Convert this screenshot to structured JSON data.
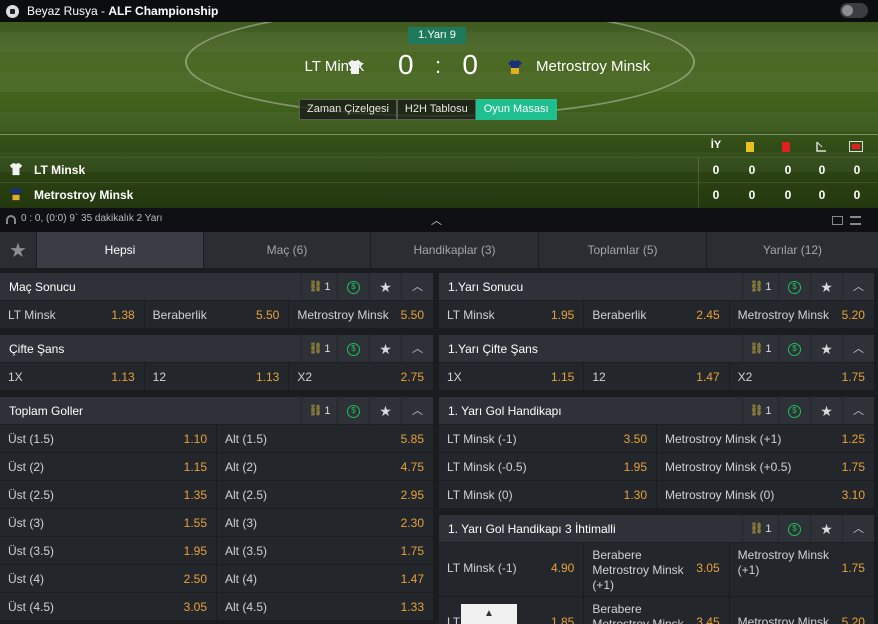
{
  "header": {
    "sport": "Beyaz Rusya",
    "separator": " - ",
    "league": "ALF Championship"
  },
  "match": {
    "period": "1.Yarı 9",
    "home_team": "LT Minsk",
    "away_team": "Metrostroy Minsk",
    "home_score": "0",
    "colon": ":",
    "away_score": "0",
    "view_tabs": [
      "Zaman Çizelgesi",
      "H2H Tablosu",
      "Oyun Masası"
    ],
    "active_view": "Oyun Masası"
  },
  "stats": {
    "ht_label": "İY",
    "rows": [
      {
        "team": "LT Minsk",
        "values": [
          "0",
          "0",
          "0",
          "0",
          "0"
        ]
      },
      {
        "team": "Metrostroy Minsk",
        "values": [
          "0",
          "0",
          "0",
          "0",
          "0"
        ]
      }
    ]
  },
  "info": {
    "text": "0 : 0, (0:0) 9` 35 dakikalık 2 Yarı"
  },
  "tabs": [
    {
      "label": "Hepsi",
      "active": true
    },
    {
      "label": "Maç (6)"
    },
    {
      "label": "Handikaplar (3)"
    },
    {
      "label": "Toplamlar (5)"
    },
    {
      "label": "Yarılar (12)"
    }
  ],
  "markets_left": [
    {
      "title": "Maç Sonucu",
      "links": "1",
      "rows": [
        [
          {
            "l": "LT Minsk",
            "o": "1.38"
          },
          {
            "l": "Beraberlik",
            "o": "5.50"
          },
          {
            "l": "Metrostroy Minsk",
            "o": "5.50"
          }
        ]
      ]
    },
    {
      "title": "Çifte Şans",
      "links": "1",
      "rows": [
        [
          {
            "l": "1X",
            "o": "1.13"
          },
          {
            "l": "12",
            "o": "1.13"
          },
          {
            "l": "X2",
            "o": "2.75"
          }
        ]
      ]
    },
    {
      "title": "Toplam Goller",
      "links": "1",
      "rows": [
        [
          {
            "l": "Üst (1.5)",
            "o": "1.10"
          },
          {
            "l": "Alt (1.5)",
            "o": "5.85"
          }
        ],
        [
          {
            "l": "Üst (2)",
            "o": "1.15"
          },
          {
            "l": "Alt (2)",
            "o": "4.75"
          }
        ],
        [
          {
            "l": "Üst (2.5)",
            "o": "1.35"
          },
          {
            "l": "Alt (2.5)",
            "o": "2.95"
          }
        ],
        [
          {
            "l": "Üst (3)",
            "o": "1.55"
          },
          {
            "l": "Alt (3)",
            "o": "2.30"
          }
        ],
        [
          {
            "l": "Üst (3.5)",
            "o": "1.95"
          },
          {
            "l": "Alt (3.5)",
            "o": "1.75"
          }
        ],
        [
          {
            "l": "Üst (4)",
            "o": "2.50"
          },
          {
            "l": "Alt (4)",
            "o": "1.47"
          }
        ],
        [
          {
            "l": "Üst (4.5)",
            "o": "3.05"
          },
          {
            "l": "Alt (4.5)",
            "o": "1.33"
          }
        ]
      ]
    }
  ],
  "markets_right": [
    {
      "title": "1.Yarı Sonucu",
      "links": "1",
      "rows": [
        [
          {
            "l": "LT Minsk",
            "o": "1.95"
          },
          {
            "l": "Beraberlik",
            "o": "2.45"
          },
          {
            "l": "Metrostroy Minsk",
            "o": "5.20"
          }
        ]
      ]
    },
    {
      "title": "1.Yarı Çifte Şans",
      "links": "1",
      "rows": [
        [
          {
            "l": "1X",
            "o": "1.15"
          },
          {
            "l": "12",
            "o": "1.47"
          },
          {
            "l": "X2",
            "o": "1.75"
          }
        ]
      ]
    },
    {
      "title": "1. Yarı Gol Handikapı",
      "links": "1",
      "rows": [
        [
          {
            "l": "LT Minsk (-1)",
            "o": "3.50"
          },
          {
            "l": "Metrostroy Minsk (+1)",
            "o": "1.25"
          }
        ],
        [
          {
            "l": "LT Minsk (-0.5)",
            "o": "1.95"
          },
          {
            "l": "Metrostroy Minsk (+0.5)",
            "o": "1.75"
          }
        ],
        [
          {
            "l": "LT Minsk (0)",
            "o": "1.30"
          },
          {
            "l": "Metrostroy Minsk (0)",
            "o": "3.10"
          }
        ]
      ]
    },
    {
      "title": "1. Yarı Gol Handikapı 3 İhtimalli",
      "links": "1",
      "tall": true,
      "rows": [
        [
          {
            "l": "LT Minsk (-1)",
            "o": "4.90"
          },
          {
            "l": "Berabere\nMetrostroy Minsk\n(+1)",
            "o": "3.05"
          },
          {
            "l": "Metrostroy Minsk\n(+1)",
            "o": "1.75"
          }
        ],
        [
          {
            "l": "LT Minsk (-2)",
            "o": "1.85"
          },
          {
            "l": "Berabere\nMetrostroy Minsk",
            "o": "3.45"
          },
          {
            "l": "Metrostroy Minsk",
            "o": "5.20"
          }
        ]
      ]
    }
  ],
  "scroll_top": "▲",
  "colors": {
    "accent": "#1fbf8f",
    "odds": "#e8a23a",
    "link": "#c9b83a",
    "cash": "#1fbf5a"
  }
}
